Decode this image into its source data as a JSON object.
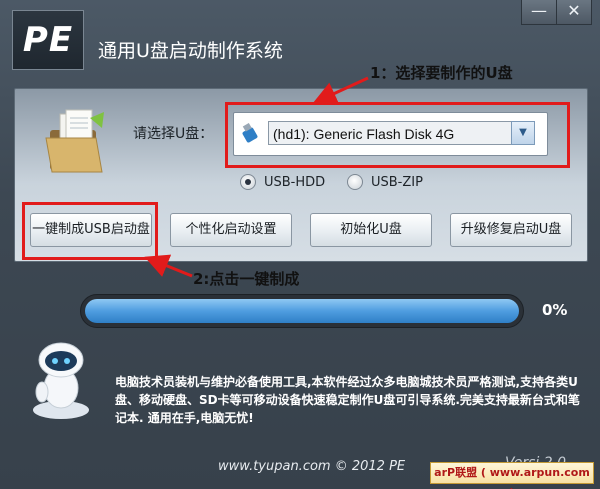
{
  "window": {
    "minimize_glyph": "—",
    "close_glyph": "✕"
  },
  "app": {
    "logo": "PE",
    "title": "通用U盘启动制作系统"
  },
  "annotations": {
    "step1": "1：选择要制作的U盘",
    "step2": "2:点击一键制成"
  },
  "select": {
    "label": "请选择U盘：",
    "value": "(hd1): Generic Flash Disk 4G"
  },
  "modes": [
    {
      "label": "USB-HDD",
      "selected": true
    },
    {
      "label": "USB-ZIP",
      "selected": false
    }
  ],
  "buttons": {
    "oneclick": "一键制成USB启动盘",
    "personalize": "个性化启动设置",
    "init": "初始化U盘",
    "upgrade": "升级修复启动U盘"
  },
  "progress": {
    "value": 1.0,
    "label": "0%"
  },
  "info": "电脑技术员装机与维护必备使用工具,本软件经过众多电脑城技术员严格测试,支持各类U盘、移动硬盘、SD卡等可移动设备快速稳定制作U盘可引导系统.完美支持最新台式和笔记本. 通用在手,电脑无忧!",
  "footer": {
    "site": "www.tyupan.com  © 2012 PE",
    "version": "Versi 2.0",
    "watermark": "arP联盟 ( www.arpun.com )"
  },
  "colors": {
    "accent_red": "#e11b1b",
    "progress_blue": "#4f9de0"
  }
}
